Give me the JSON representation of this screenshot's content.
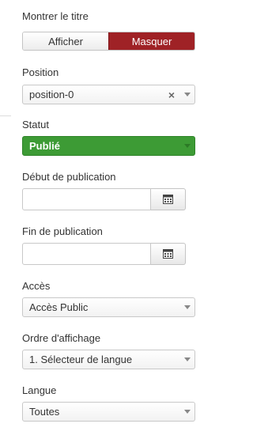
{
  "show_title": {
    "label": "Montrer le titre",
    "options": [
      "Afficher",
      "Masquer"
    ],
    "selected": "Masquer"
  },
  "position": {
    "label": "Position",
    "value": "position-0",
    "clear_symbol": "×"
  },
  "status": {
    "label": "Statut",
    "value": "Publié",
    "color": "#3d9b35"
  },
  "publish_up": {
    "label": "Début de publication",
    "value": "",
    "button_icon": "calendar-icon"
  },
  "publish_down": {
    "label": "Fin de publication",
    "value": "",
    "button_icon": "calendar-icon"
  },
  "access": {
    "label": "Accès",
    "value": "Accès Public"
  },
  "ordering": {
    "label": "Ordre d'affichage",
    "value": "1. Sélecteur de langue"
  },
  "language": {
    "label": "Langue",
    "value": "Toutes"
  },
  "colors": {
    "toggle_active": "#9f2226",
    "status_published": "#3d9b35"
  }
}
